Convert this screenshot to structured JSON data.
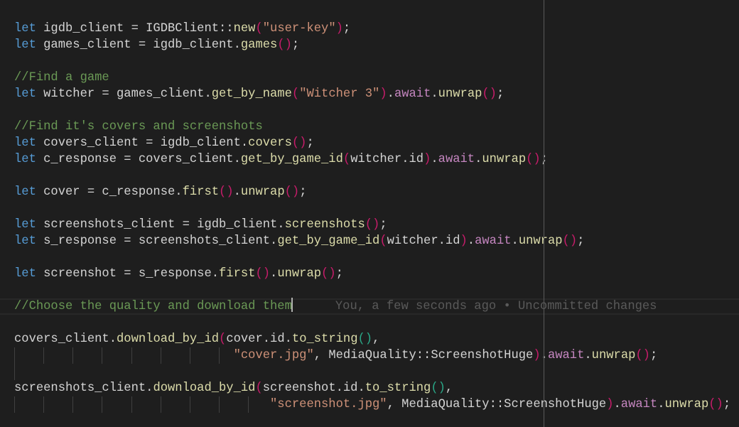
{
  "editor": {
    "lines": [
      [
        {
          "t": "let",
          "c": "kw"
        },
        {
          "t": " igdb_client = IGDBClient::",
          "c": "var"
        },
        {
          "t": "new",
          "c": "fn"
        },
        {
          "t": "(",
          "c": "p1"
        },
        {
          "t": "\"user-key\"",
          "c": "str"
        },
        {
          "t": ")",
          "c": "p1"
        },
        {
          "t": ";",
          "c": "punc"
        }
      ],
      [
        {
          "t": "let",
          "c": "kw"
        },
        {
          "t": " games_client = igdb_client.",
          "c": "var"
        },
        {
          "t": "games",
          "c": "fn"
        },
        {
          "t": "()",
          "c": "p1"
        },
        {
          "t": ";",
          "c": "punc"
        }
      ],
      [],
      [
        {
          "t": "//Find a game",
          "c": "cm"
        }
      ],
      [
        {
          "t": "let",
          "c": "kw"
        },
        {
          "t": " witcher = games_client.",
          "c": "var"
        },
        {
          "t": "get_by_name",
          "c": "fn"
        },
        {
          "t": "(",
          "c": "p1"
        },
        {
          "t": "\"Witcher 3\"",
          "c": "str"
        },
        {
          "t": ")",
          "c": "p1"
        },
        {
          "t": ".",
          "c": "punc"
        },
        {
          "t": "await",
          "c": "await"
        },
        {
          "t": ".",
          "c": "punc"
        },
        {
          "t": "unwrap",
          "c": "fn"
        },
        {
          "t": "()",
          "c": "p1"
        },
        {
          "t": ";",
          "c": "punc"
        }
      ],
      [],
      [
        {
          "t": "//Find it's covers and screenshots",
          "c": "cm"
        }
      ],
      [
        {
          "t": "let",
          "c": "kw"
        },
        {
          "t": " covers_client = igdb_client.",
          "c": "var"
        },
        {
          "t": "covers",
          "c": "fn"
        },
        {
          "t": "()",
          "c": "p1"
        },
        {
          "t": ";",
          "c": "punc"
        }
      ],
      [
        {
          "t": "let",
          "c": "kw"
        },
        {
          "t": " c_response = covers_client.",
          "c": "var"
        },
        {
          "t": "get_by_game_id",
          "c": "fn"
        },
        {
          "t": "(",
          "c": "p1"
        },
        {
          "t": "witcher.id",
          "c": "var"
        },
        {
          "t": ")",
          "c": "p1"
        },
        {
          "t": ".",
          "c": "punc"
        },
        {
          "t": "await",
          "c": "await"
        },
        {
          "t": ".",
          "c": "punc"
        },
        {
          "t": "unwrap",
          "c": "fn"
        },
        {
          "t": "()",
          "c": "p1"
        },
        {
          "t": ";",
          "c": "punc"
        }
      ],
      [],
      [
        {
          "t": "let",
          "c": "kw"
        },
        {
          "t": " cover = c_response.",
          "c": "var"
        },
        {
          "t": "first",
          "c": "fn"
        },
        {
          "t": "()",
          "c": "p1"
        },
        {
          "t": ".",
          "c": "punc"
        },
        {
          "t": "unwrap",
          "c": "fn"
        },
        {
          "t": "()",
          "c": "p1"
        },
        {
          "t": ";",
          "c": "punc"
        }
      ],
      [],
      [
        {
          "t": "let",
          "c": "kw"
        },
        {
          "t": " screenshots_client = igdb_client.",
          "c": "var"
        },
        {
          "t": "screenshots",
          "c": "fn"
        },
        {
          "t": "()",
          "c": "p1"
        },
        {
          "t": ";",
          "c": "punc"
        }
      ],
      [
        {
          "t": "let",
          "c": "kw"
        },
        {
          "t": " s_response = screenshots_client.",
          "c": "var"
        },
        {
          "t": "get_by_game_id",
          "c": "fn"
        },
        {
          "t": "(",
          "c": "p1"
        },
        {
          "t": "witcher.id",
          "c": "var"
        },
        {
          "t": ")",
          "c": "p1"
        },
        {
          "t": ".",
          "c": "punc"
        },
        {
          "t": "await",
          "c": "await"
        },
        {
          "t": ".",
          "c": "punc"
        },
        {
          "t": "unwrap",
          "c": "fn"
        },
        {
          "t": "()",
          "c": "p1"
        },
        {
          "t": ";",
          "c": "punc"
        }
      ],
      [],
      [
        {
          "t": "let",
          "c": "kw"
        },
        {
          "t": " screenshot = s_response.",
          "c": "var"
        },
        {
          "t": "first",
          "c": "fn"
        },
        {
          "t": "()",
          "c": "p1"
        },
        {
          "t": ".",
          "c": "punc"
        },
        {
          "t": "unwrap",
          "c": "fn"
        },
        {
          "t": "()",
          "c": "p1"
        },
        {
          "t": ";",
          "c": "punc"
        }
      ],
      [],
      [
        {
          "t": "//Choose the quality and download them",
          "c": "cm"
        }
      ],
      [],
      [
        {
          "t": "covers_client.",
          "c": "var"
        },
        {
          "t": "download_by_id",
          "c": "fn"
        },
        {
          "t": "(",
          "c": "p1"
        },
        {
          "t": "cover.id.",
          "c": "var"
        },
        {
          "t": "to_string",
          "c": "fn"
        },
        {
          "t": "()",
          "c": "p2"
        },
        {
          "t": ",",
          "c": "punc"
        }
      ],
      [
        {
          "t": "                              ",
          "c": "var"
        },
        {
          "t": "\"cover.jpg\"",
          "c": "str"
        },
        {
          "t": ", MediaQuality::ScreenshotHuge",
          "c": "type"
        },
        {
          "t": ")",
          "c": "p1"
        },
        {
          "t": ".",
          "c": "punc"
        },
        {
          "t": "await",
          "c": "await"
        },
        {
          "t": ".",
          "c": "punc"
        },
        {
          "t": "unwrap",
          "c": "fn"
        },
        {
          "t": "()",
          "c": "p1"
        },
        {
          "t": ";",
          "c": "punc"
        }
      ],
      [],
      [
        {
          "t": "screenshots_client.",
          "c": "var"
        },
        {
          "t": "download_by_id",
          "c": "fn"
        },
        {
          "t": "(",
          "c": "p1"
        },
        {
          "t": "screenshot.id.",
          "c": "var"
        },
        {
          "t": "to_string",
          "c": "fn"
        },
        {
          "t": "()",
          "c": "p2"
        },
        {
          "t": ",",
          "c": "punc"
        }
      ],
      [
        {
          "t": "                                   ",
          "c": "var"
        },
        {
          "t": "\"screenshot.jpg\"",
          "c": "str"
        },
        {
          "t": ", MediaQuality::ScreenshotHuge",
          "c": "type"
        },
        {
          "t": ")",
          "c": "p1"
        },
        {
          "t": ".",
          "c": "punc"
        },
        {
          "t": "await",
          "c": "await"
        },
        {
          "t": ".",
          "c": "punc"
        },
        {
          "t": "unwrap",
          "c": "fn"
        },
        {
          "t": "()",
          "c": "p1"
        },
        {
          "t": ";",
          "c": "punc"
        }
      ]
    ],
    "current_line_index": 17,
    "git_blame": "You, a few seconds ago • Uncommitted changes"
  },
  "colors": {
    "background": "#1e1e1e",
    "keyword": "#569cd6",
    "function": "#dcdcaa",
    "string": "#ce9178",
    "comment": "#6a9955",
    "await": "#c586c0",
    "bracket_level1": "#c71c6a",
    "bracket_level2": "#2aa787"
  }
}
